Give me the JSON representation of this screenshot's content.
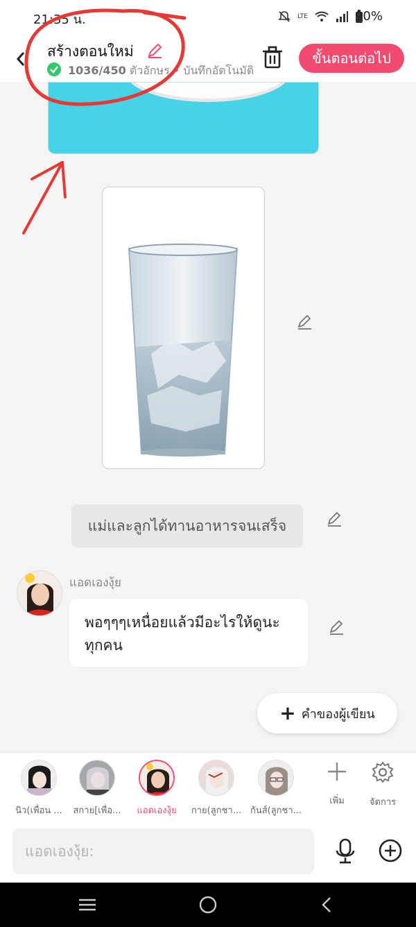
{
  "status_bar": {
    "time": "21:35 น.",
    "battery": "90%",
    "network": "LTE"
  },
  "header": {
    "title": "สร้างตอนใหม่",
    "save_count": "1036/450",
    "save_status": "ตัวอักษร • บันทึกอัตโนมัติ",
    "next_button": "ขั้นตอนต่อไป"
  },
  "messages": {
    "narration": "แม่และลูกได้ทานอาหารจนเสร็จ",
    "chat_name": "แอดเองงุ้ย",
    "chat_text": "พอๆๆๆเหนื่อยแล้วมีอะไรให้ดูนะทุกคน"
  },
  "author_button": "คำของผู้เขียน",
  "characters": [
    {
      "name": "นิว(เพื่อน ...",
      "active": false
    },
    {
      "name": "สกาย[เพื่อ...",
      "active": false
    },
    {
      "name": "แอดเองงุ้ย",
      "active": true
    },
    {
      "name": "กาย(ลูกชา...",
      "active": false
    },
    {
      "name": "กันส์(ลูกชา...",
      "active": false
    }
  ],
  "tools": {
    "add": "เพิ่ม",
    "manage": "จัดการ"
  },
  "input": {
    "placeholder": "แอดเองงุ้ย:"
  },
  "colors": {
    "accent": "#f14b6f",
    "check": "#35c56a",
    "annotation": "#e53935"
  }
}
